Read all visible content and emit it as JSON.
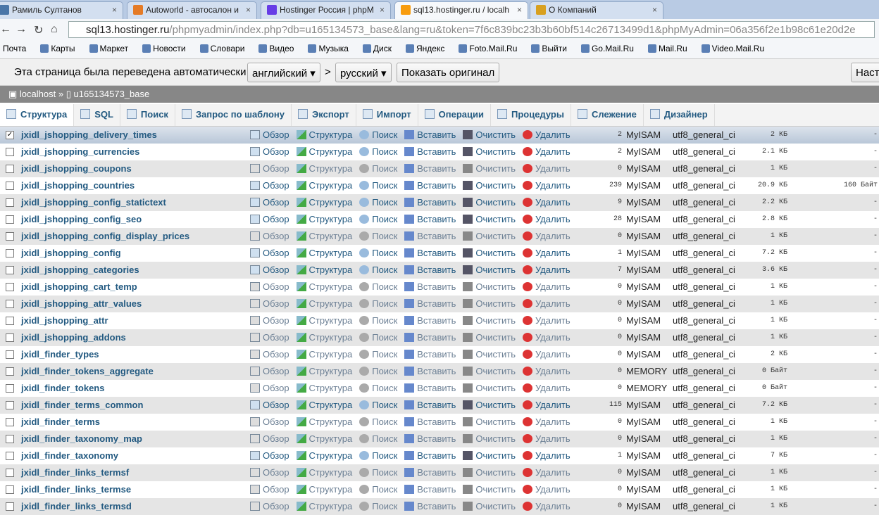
{
  "browser": {
    "tabs": [
      {
        "title": "Рамиль Султанов",
        "icon": "vk-icon"
      },
      {
        "title": "Autoworld - автосалон и",
        "icon": "joomla-icon"
      },
      {
        "title": "Hostinger Россия | phpM",
        "icon": "hostinger-icon"
      },
      {
        "title": "sql13.hostinger.ru / localh",
        "icon": "pma-icon"
      },
      {
        "title": "О Компаний",
        "icon": "site-icon"
      }
    ],
    "url_host": "sql13.hostinger.ru",
    "url_path": "/phpmyadmin/index.php?db=u165134573_base&lang=ru&token=7f6c839bc23b3b60bf514c26713499d1&phpMyAdmin=06a356f2e1b98c61e20d2e",
    "bookmarks": [
      "Почта",
      "Карты",
      "Маркет",
      "Новости",
      "Словари",
      "Видео",
      "Музыка",
      "Диск",
      "Яндекс",
      "Foto.Mail.Ru",
      "Выйти",
      "Go.Mail.Ru",
      "Mail.Ru",
      "Video.Mail.Ru"
    ]
  },
  "translate": {
    "text": "Эта страница была переведена автоматически",
    "from": "английский",
    "arrow": ">",
    "to": "русский",
    "show_original": "Показать оригинал",
    "settings": "Настройки"
  },
  "breadcrumb": {
    "server": "localhost",
    "sep": "»",
    "db": "u165134573_base"
  },
  "menu": [
    "Структура",
    "SQL",
    "Поиск",
    "Запрос по шаблону",
    "Экспорт",
    "Импорт",
    "Операции",
    "Процедуры",
    "Слежение",
    "Дизайнер"
  ],
  "actions": {
    "browse": "Обзор",
    "structure": "Структура",
    "search": "Поиск",
    "insert": "Вставить",
    "empty": "Очистить",
    "drop": "Удалить"
  },
  "tables": [
    {
      "name": "jxidl_jshopping_delivery_times",
      "rows": "2",
      "engine": "MyISAM",
      "collation": "utf8_general_ci",
      "size": "2 КБ",
      "overhead": "-",
      "checked": true
    },
    {
      "name": "jxidl_jshopping_currencies",
      "rows": "2",
      "engine": "MyISAM",
      "collation": "utf8_general_ci",
      "size": "2.1 КБ",
      "overhead": "-"
    },
    {
      "name": "jxidl_jshopping_coupons",
      "rows": "0",
      "engine": "MyISAM",
      "collation": "utf8_general_ci",
      "size": "1 КБ",
      "overhead": "-"
    },
    {
      "name": "jxidl_jshopping_countries",
      "rows": "239",
      "engine": "MyISAM",
      "collation": "utf8_general_ci",
      "size": "20.9 КБ",
      "overhead": "160 Байт"
    },
    {
      "name": "jxidl_jshopping_config_statictext",
      "rows": "9",
      "engine": "MyISAM",
      "collation": "utf8_general_ci",
      "size": "2.2 КБ",
      "overhead": "-"
    },
    {
      "name": "jxidl_jshopping_config_seo",
      "rows": "28",
      "engine": "MyISAM",
      "collation": "utf8_general_ci",
      "size": "2.8 КБ",
      "overhead": "-"
    },
    {
      "name": "jxidl_jshopping_config_display_prices",
      "rows": "0",
      "engine": "MyISAM",
      "collation": "utf8_general_ci",
      "size": "1 КБ",
      "overhead": "-"
    },
    {
      "name": "jxidl_jshopping_config",
      "rows": "1",
      "engine": "MyISAM",
      "collation": "utf8_general_ci",
      "size": "7.2 КБ",
      "overhead": "-"
    },
    {
      "name": "jxidl_jshopping_categories",
      "rows": "7",
      "engine": "MyISAM",
      "collation": "utf8_general_ci",
      "size": "3.6 КБ",
      "overhead": "-"
    },
    {
      "name": "jxidl_jshopping_cart_temp",
      "rows": "0",
      "engine": "MyISAM",
      "collation": "utf8_general_ci",
      "size": "1 КБ",
      "overhead": "-"
    },
    {
      "name": "jxidl_jshopping_attr_values",
      "rows": "0",
      "engine": "MyISAM",
      "collation": "utf8_general_ci",
      "size": "1 КБ",
      "overhead": "-"
    },
    {
      "name": "jxidl_jshopping_attr",
      "rows": "0",
      "engine": "MyISAM",
      "collation": "utf8_general_ci",
      "size": "1 КБ",
      "overhead": "-"
    },
    {
      "name": "jxidl_jshopping_addons",
      "rows": "0",
      "engine": "MyISAM",
      "collation": "utf8_general_ci",
      "size": "1 КБ",
      "overhead": "-"
    },
    {
      "name": "jxidl_finder_types",
      "rows": "0",
      "engine": "MyISAM",
      "collation": "utf8_general_ci",
      "size": "2 КБ",
      "overhead": "-"
    },
    {
      "name": "jxidl_finder_tokens_aggregate",
      "rows": "0",
      "engine": "MEMORY",
      "collation": "utf8_general_ci",
      "size": "0 Байт",
      "overhead": "-"
    },
    {
      "name": "jxidl_finder_tokens",
      "rows": "0",
      "engine": "MEMORY",
      "collation": "utf8_general_ci",
      "size": "0 Байт",
      "overhead": "-"
    },
    {
      "name": "jxidl_finder_terms_common",
      "rows": "115",
      "engine": "MyISAM",
      "collation": "utf8_general_ci",
      "size": "7.2 КБ",
      "overhead": "-"
    },
    {
      "name": "jxidl_finder_terms",
      "rows": "0",
      "engine": "MyISAM",
      "collation": "utf8_general_ci",
      "size": "1 КБ",
      "overhead": "-"
    },
    {
      "name": "jxidl_finder_taxonomy_map",
      "rows": "0",
      "engine": "MyISAM",
      "collation": "utf8_general_ci",
      "size": "1 КБ",
      "overhead": "-"
    },
    {
      "name": "jxidl_finder_taxonomy",
      "rows": "1",
      "engine": "MyISAM",
      "collation": "utf8_general_ci",
      "size": "7 КБ",
      "overhead": "-"
    },
    {
      "name": "jxidl_finder_links_termsf",
      "rows": "0",
      "engine": "MyISAM",
      "collation": "utf8_general_ci",
      "size": "1 КБ",
      "overhead": "-"
    },
    {
      "name": "jxidl_finder_links_termse",
      "rows": "0",
      "engine": "MyISAM",
      "collation": "utf8_general_ci",
      "size": "1 КБ",
      "overhead": "-"
    },
    {
      "name": "jxidl_finder_links_termsd",
      "rows": "0",
      "engine": "MyISAM",
      "collation": "utf8_general_ci",
      "size": "1 КБ",
      "overhead": "-"
    }
  ]
}
